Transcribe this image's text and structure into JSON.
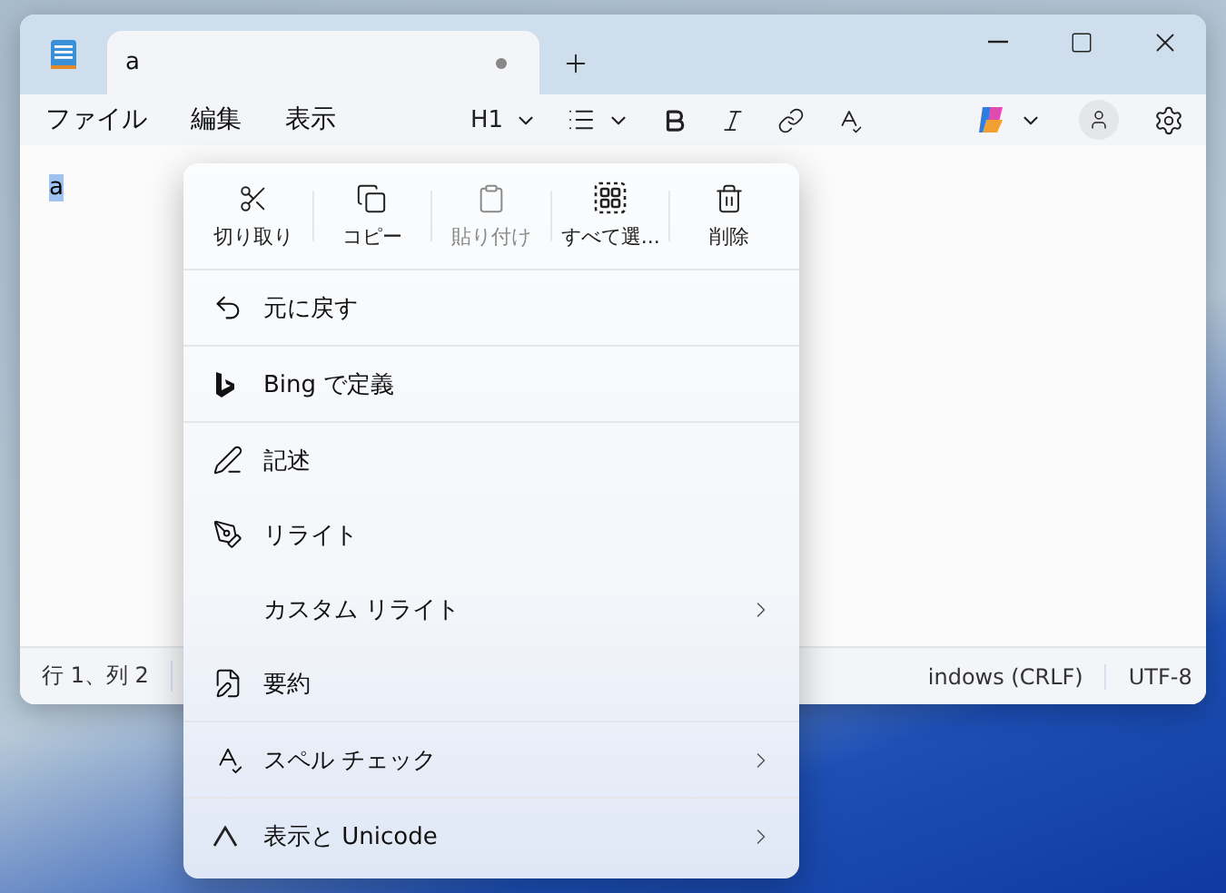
{
  "window": {
    "tab": {
      "title": "a",
      "unsaved": true
    }
  },
  "menu_bar": [
    "ファイル",
    "編集",
    "表示"
  ],
  "toolbar": {
    "heading": "H1"
  },
  "editor": {
    "text": "a",
    "selected": true
  },
  "status_bar": [
    "行 1、列 2",
    "indows (CRLF)",
    "UTF-8"
  ],
  "context_menu": {
    "actions": [
      {
        "label": "切り取り",
        "disabled": false
      },
      {
        "label": "コピー",
        "disabled": false
      },
      {
        "label": "貼り付け",
        "disabled": true
      },
      {
        "label": "すべて選...",
        "disabled": false
      },
      {
        "label": "削除",
        "disabled": false
      }
    ],
    "groups": [
      [
        {
          "label": "元に戻す",
          "submenu": false
        }
      ],
      [
        {
          "label": "Bing で定義",
          "submenu": false
        }
      ],
      [
        {
          "label": "記述",
          "submenu": false
        },
        {
          "label": "リライト",
          "submenu": false
        },
        {
          "label": "カスタム リライト",
          "submenu": true
        },
        {
          "label": "要約",
          "submenu": false
        }
      ],
      [
        {
          "label": "スペル チェック",
          "submenu": true
        }
      ],
      [
        {
          "label": "表示と Unicode",
          "submenu": true
        }
      ]
    ]
  }
}
